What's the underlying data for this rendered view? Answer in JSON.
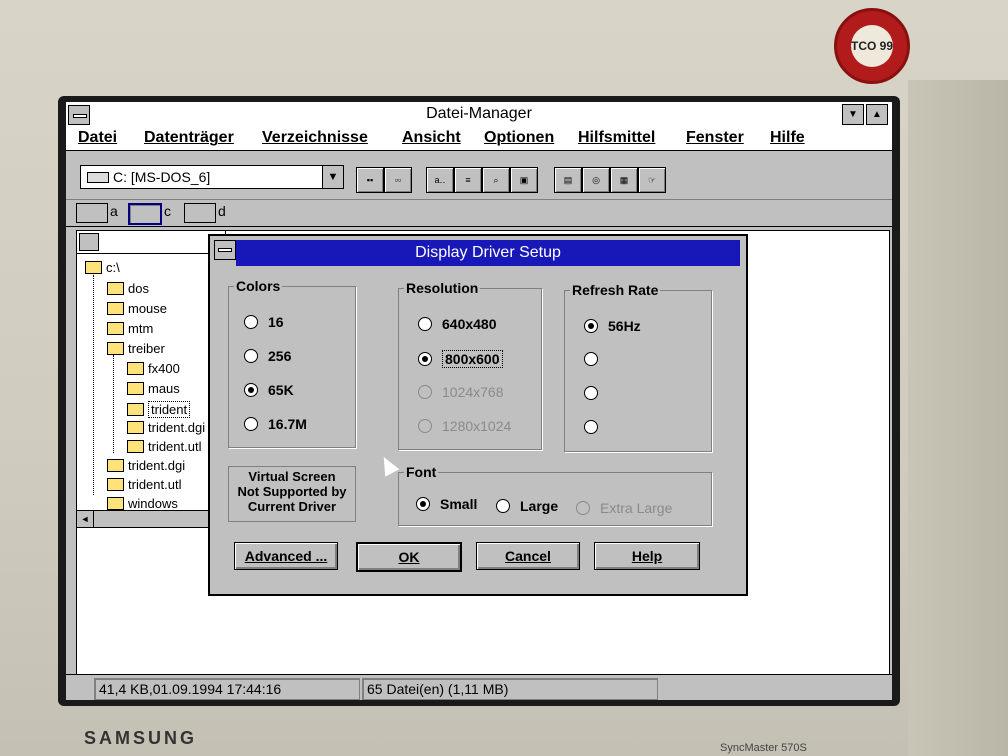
{
  "monitor": {
    "brand": "SAMSUNG",
    "model": "SyncMaster 570S",
    "badge_text": "TCO 99",
    "badge_ring": "ECOLOGY ENERGY EMISSIONS ERGONOMICS"
  },
  "app": {
    "title": "Datei-Manager",
    "menu": [
      "Datei",
      "Datenträger",
      "Verzeichnisse",
      "Ansicht",
      "Optionen",
      "Hilfsmittel",
      "Fenster",
      "Hilfe"
    ]
  },
  "toolbar": {
    "drive_value": "C: [MS-DOS_6]",
    "drive_arrow": "▼"
  },
  "drives": [
    {
      "label": "a"
    },
    {
      "label": "c"
    },
    {
      "label": "d"
    }
  ],
  "tree": {
    "root": "c:\\",
    "items": [
      "dos",
      "mouse",
      "mtm",
      "treiber",
      "fx400",
      "maus",
      "trident",
      "trident.dgi",
      "trident.utl",
      "trident.dgi",
      "trident.utl",
      "windows"
    ]
  },
  "dialog": {
    "title": "Display Driver Setup",
    "colors": {
      "label": "Colors",
      "options": [
        "16",
        "256",
        "65K",
        "16.7M"
      ],
      "selected": "65K"
    },
    "resolution": {
      "label": "Resolution",
      "options": [
        "640x480",
        "800x600",
        "1024x768",
        "1280x1024"
      ],
      "selected": "800x600",
      "disabled": [
        "1024x768",
        "1280x1024"
      ]
    },
    "refresh": {
      "label": "Refresh Rate",
      "options": [
        "56Hz",
        "",
        "",
        ""
      ],
      "selected": "56Hz"
    },
    "font": {
      "label": "Font",
      "options": [
        "Small",
        "Large",
        "Extra Large"
      ],
      "selected": "Small",
      "disabled": [
        "Extra Large"
      ]
    },
    "virtual_note": [
      "Virtual Screen",
      "Not Supported by",
      "Current Driver"
    ],
    "buttons": {
      "advanced": "Advanced ...",
      "ok": "OK",
      "cancel": "Cancel",
      "help": "Help"
    }
  },
  "status": {
    "left": "41,4 KB,01.09.1994 17:44:16",
    "right": "65 Datei(en) (1,11 MB)"
  }
}
